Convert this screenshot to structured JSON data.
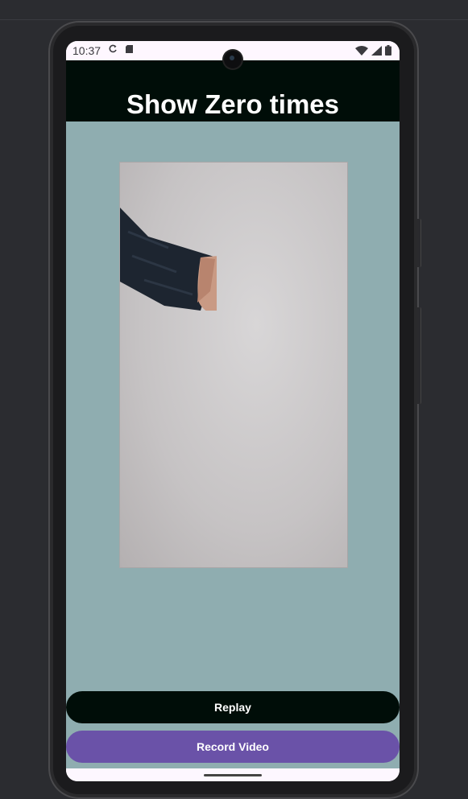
{
  "status_bar": {
    "time": "10:37",
    "left_icons": [
      "sync-icon",
      "sd-card-icon"
    ],
    "right_icons": [
      "wifi-icon",
      "signal-icon",
      "battery-icon"
    ]
  },
  "header": {
    "title": "Show Zero times"
  },
  "video": {
    "description_icon": "video-preview"
  },
  "buttons": {
    "replay": "Replay",
    "record": "Record Video"
  },
  "colors": {
    "header_bg": "#000d08",
    "content_bg": "#8fadb0",
    "record_button": "#6a52a8",
    "replay_button": "#000d08"
  }
}
